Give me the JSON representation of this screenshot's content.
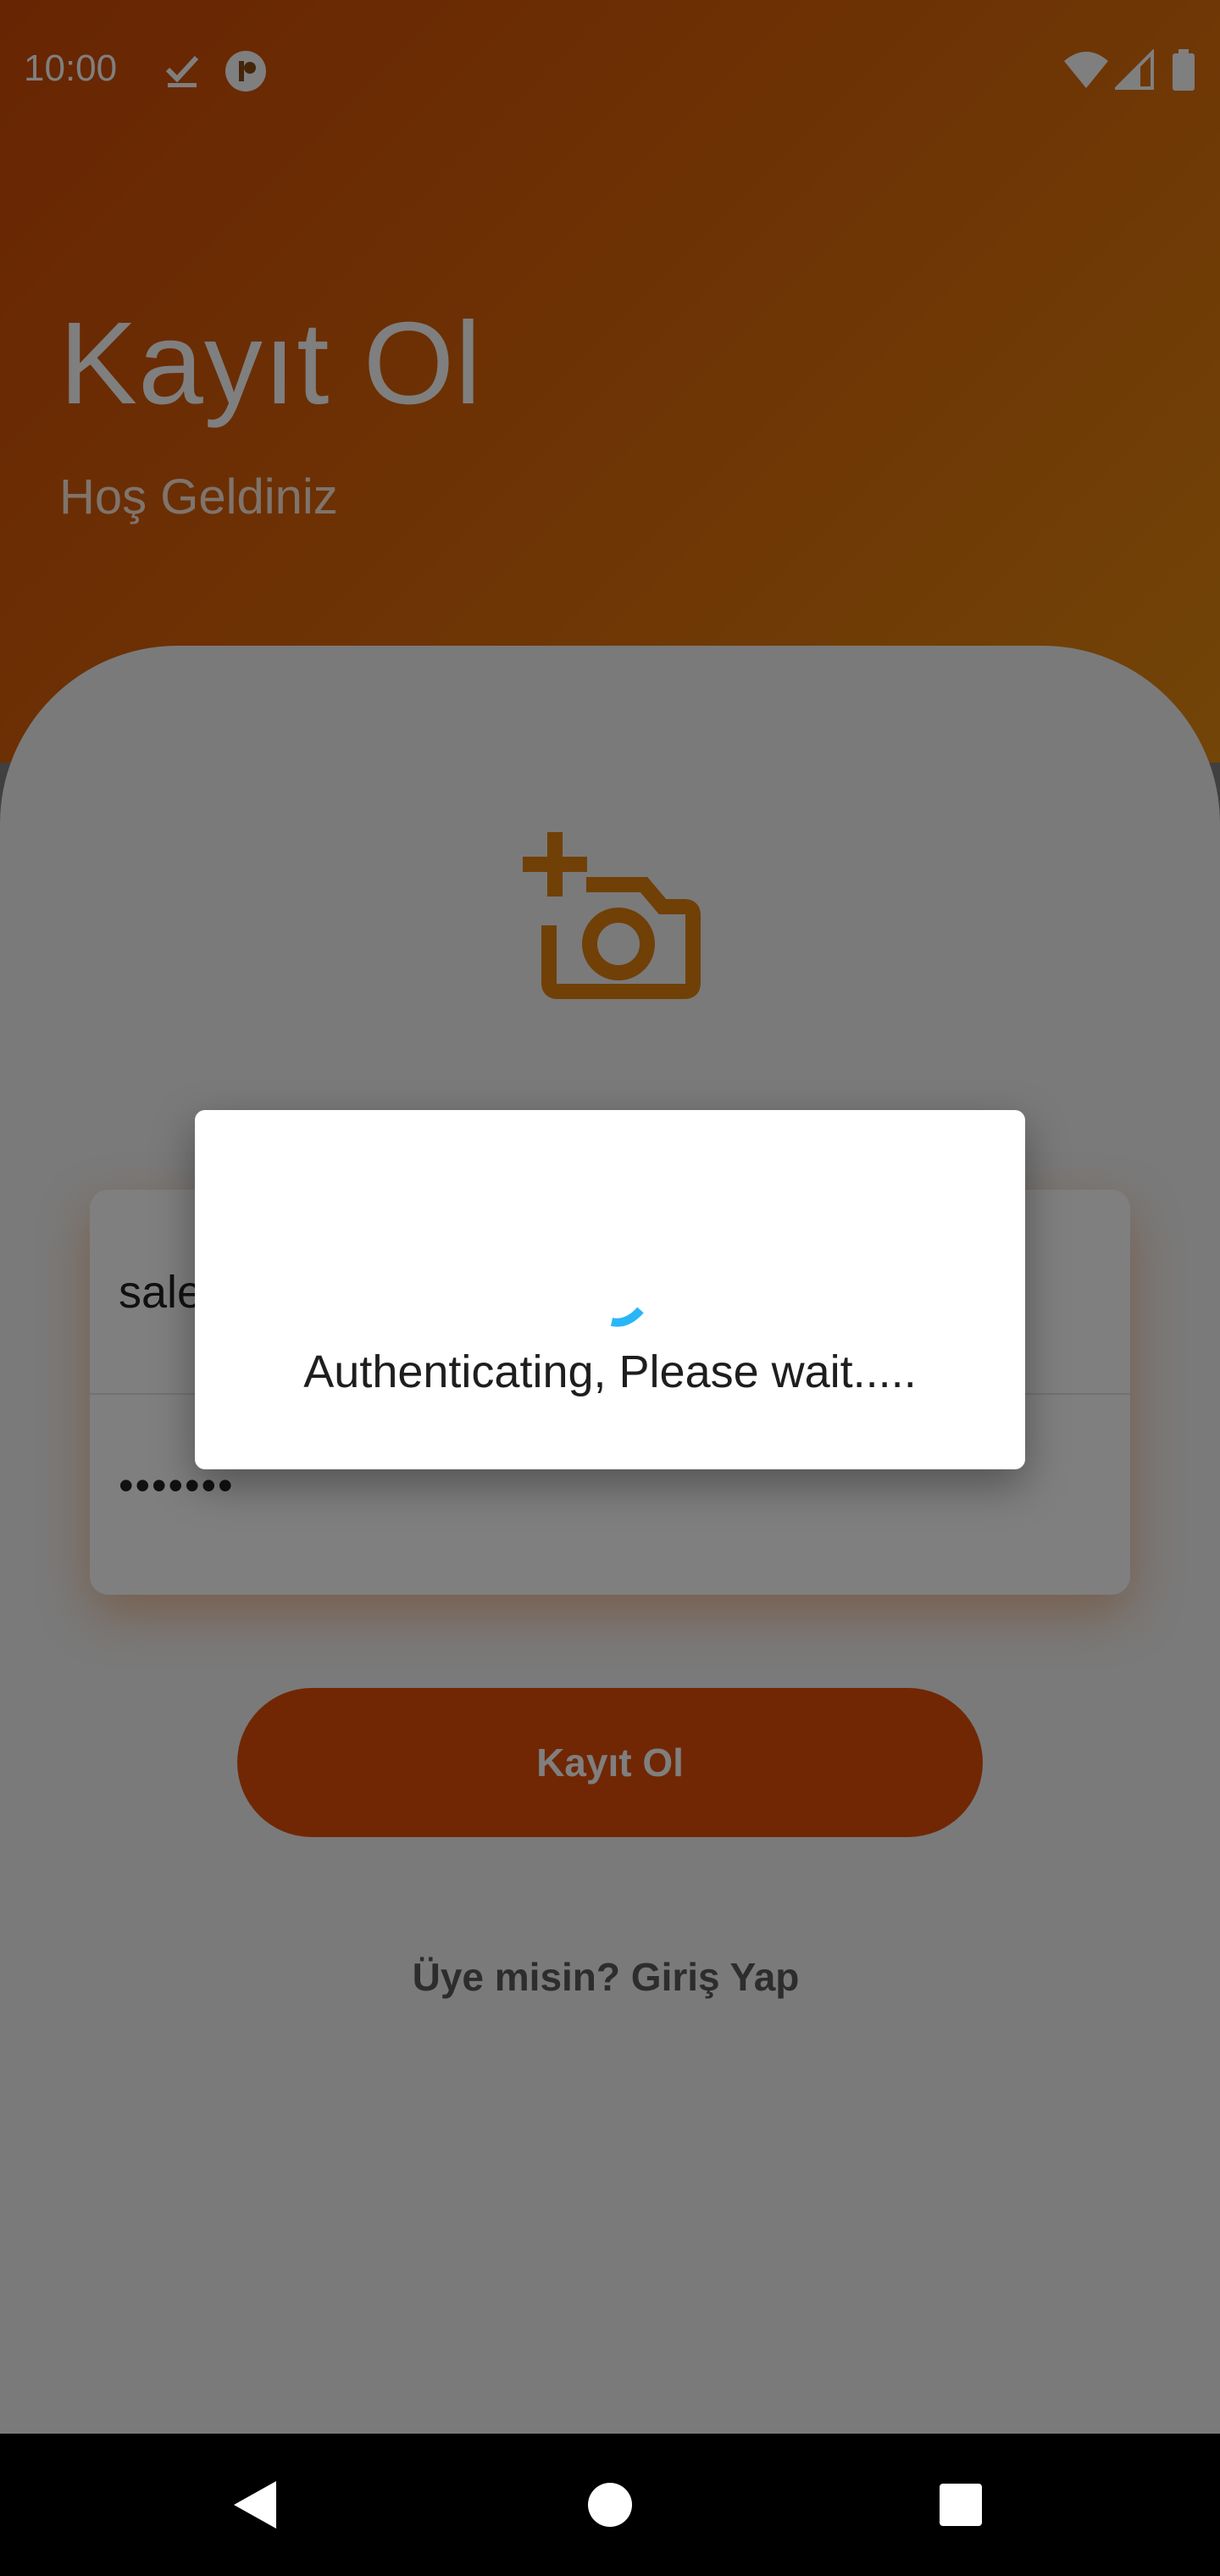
{
  "status_bar": {
    "time": "10:00",
    "icons_left": [
      "check-icon",
      "app-badge-icon"
    ],
    "icons_right": [
      "wifi-icon",
      "signal-icon",
      "battery-icon"
    ]
  },
  "header": {
    "title": "Kayıt Ol",
    "subtitle": "Hoş Geldiniz"
  },
  "form": {
    "photo_icon": "add-photo-icon",
    "email_value": "sale",
    "password_value": "•••••••"
  },
  "register_button": {
    "label": "Kayıt Ol"
  },
  "login_link": {
    "label": "Üye misin? Giriş Yap"
  },
  "dialog": {
    "message": "Authenticating, Please wait.....",
    "spinner_color": "#29b6f6"
  },
  "navigation": {
    "items": [
      "back-icon",
      "home-icon",
      "recents-icon"
    ]
  },
  "colors": {
    "brand_orange": "#e24f07",
    "header_gradient_start": "#d04a06",
    "header_gradient_end": "#e48a10"
  }
}
